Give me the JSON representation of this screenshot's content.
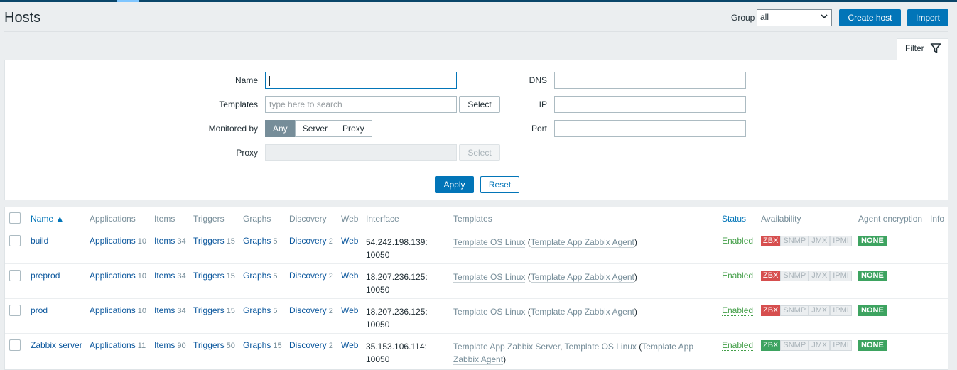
{
  "header": {
    "title": "Hosts",
    "group_label": "Group",
    "group_value": "all",
    "create_host": "Create host",
    "import": "Import"
  },
  "filter": {
    "tab_label": "Filter",
    "name_label": "Name",
    "name_value": "",
    "templates_label": "Templates",
    "templates_placeholder": "type here to search",
    "select": "Select",
    "monitored_by_label": "Monitored by",
    "monitored_by_options": [
      "Any",
      "Server",
      "Proxy"
    ],
    "monitored_by_selected": "Any",
    "proxy_label": "Proxy",
    "dns_label": "DNS",
    "ip_label": "IP",
    "port_label": "Port",
    "apply": "Apply",
    "reset": "Reset"
  },
  "table": {
    "columns": {
      "name": "Name ▲",
      "applications": "Applications",
      "items": "Items",
      "triggers": "Triggers",
      "graphs": "Graphs",
      "discovery": "Discovery",
      "web": "Web",
      "interface": "Interface",
      "templates": "Templates",
      "status": "Status",
      "availability": "Availability",
      "agent_encryption": "Agent encryption",
      "info": "Info"
    },
    "rows": [
      {
        "name": "build",
        "applications": "Applications",
        "applications_count": "10",
        "items": "Items",
        "items_count": "34",
        "triggers": "Triggers",
        "triggers_count": "15",
        "graphs": "Graphs",
        "graphs_count": "5",
        "discovery": "Discovery",
        "discovery_count": "2",
        "web": "Web",
        "interface_ip": "54.242.198.139:",
        "interface_port": "10050",
        "tpl1": "Template OS Linux",
        "tpl_open": " (",
        "tpl2": "Template App Zabbix Agent",
        "tpl_close": ")",
        "status": "Enabled",
        "zbx": "ZBX",
        "zbx_color": "#d64e4e",
        "snmp": "SNMP",
        "jmx": "JMX",
        "ipmi": "IPMI",
        "encryption": "NONE"
      },
      {
        "name": "preprod",
        "applications": "Applications",
        "applications_count": "10",
        "items": "Items",
        "items_count": "34",
        "triggers": "Triggers",
        "triggers_count": "15",
        "graphs": "Graphs",
        "graphs_count": "5",
        "discovery": "Discovery",
        "discovery_count": "2",
        "web": "Web",
        "interface_ip": "18.207.236.125:",
        "interface_port": "10050",
        "tpl1": "Template OS Linux",
        "tpl_open": " (",
        "tpl2": "Template App Zabbix Agent",
        "tpl_close": ")",
        "status": "Enabled",
        "zbx": "ZBX",
        "zbx_color": "#d64e4e",
        "snmp": "SNMP",
        "jmx": "JMX",
        "ipmi": "IPMI",
        "encryption": "NONE"
      },
      {
        "name": "prod",
        "applications": "Applications",
        "applications_count": "10",
        "items": "Items",
        "items_count": "34",
        "triggers": "Triggers",
        "triggers_count": "15",
        "graphs": "Graphs",
        "graphs_count": "5",
        "discovery": "Discovery",
        "discovery_count": "2",
        "web": "Web",
        "interface_ip": "18.207.236.125:",
        "interface_port": "10050",
        "tpl1": "Template OS Linux",
        "tpl_open": " (",
        "tpl2": "Template App Zabbix Agent",
        "tpl_close": ")",
        "status": "Enabled",
        "zbx": "ZBX",
        "zbx_color": "#d64e4e",
        "snmp": "SNMP",
        "jmx": "JMX",
        "ipmi": "IPMI",
        "encryption": "NONE"
      },
      {
        "name": "Zabbix server",
        "applications": "Applications",
        "applications_count": "11",
        "items": "Items",
        "items_count": "90",
        "triggers": "Triggers",
        "triggers_count": "50",
        "graphs": "Graphs",
        "graphs_count": "15",
        "discovery": "Discovery",
        "discovery_count": "2",
        "web": "Web",
        "interface_ip": "35.153.106.114:",
        "interface_port": "10050",
        "tpl1": "Template App Zabbix Server",
        "tpl_mid": ", ",
        "tpl1b": "Template OS Linux",
        "tpl_open": " (",
        "tpl2": "Template App Zabbix Agent",
        "tpl_close": ")",
        "status": "Enabled",
        "zbx": "ZBX",
        "zbx_color": "#3da360",
        "snmp": "SNMP",
        "jmx": "JMX",
        "ipmi": "IPMI",
        "encryption": "NONE"
      }
    ]
  },
  "colors": {
    "accent": "#0275b8",
    "link": "#0b579d",
    "enabled": "#429e47",
    "unavailable": "#d64e4e",
    "available": "#3da360"
  }
}
